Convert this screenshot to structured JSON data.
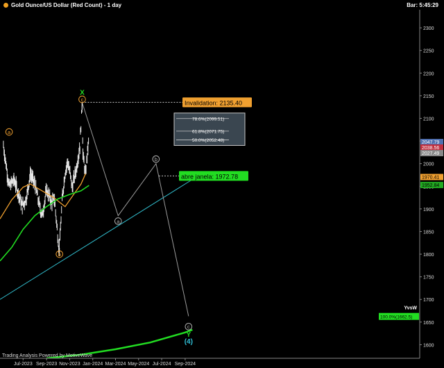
{
  "header": {
    "title": "Gold Ounce/US Dollar (Red Count) - 1 day",
    "clock": "Bar: 5:45:29"
  },
  "footer": {
    "credit": "Trading Analysis Powered by MotiveWave"
  },
  "colors": {
    "background": "#000000",
    "price": "#e8e8e8",
    "ma_orange": "#f0a030",
    "ma_green": "#22dd22",
    "channel": "#30b8c8",
    "projection": "#9a9a9a",
    "wave_orange": "#f0a030",
    "wave_green": "#22dd22",
    "wave_gray": "#b0b0b0",
    "wave_cyan": "#30c0d8"
  },
  "chart_data": {
    "type": "line",
    "title": "Gold Ounce/US Dollar (Red Count) - 1 day",
    "x_ticks": [
      "Jul-2023",
      "Sep-2023",
      "Nov-2023",
      "Jan-2024",
      "Mar-2024",
      "May-2024",
      "Jul-2024",
      "Sep-2024"
    ],
    "y_ticks": [
      1600,
      1650,
      1700,
      1750,
      1800,
      1850,
      1900,
      1950,
      2000,
      2050,
      2100,
      2150,
      2200,
      2250,
      2300
    ],
    "ylim": [
      1570,
      2340
    ],
    "price_keypoints": [
      {
        "date": "2023-05-10",
        "price": 2040
      },
      {
        "date": "2023-05-25",
        "price": 1950
      },
      {
        "date": "2023-06-07",
        "price": 1965
      },
      {
        "date": "2023-06-20",
        "price": 1930
      },
      {
        "date": "2023-06-29",
        "price": 1905
      },
      {
        "date": "2023-07-10",
        "price": 1925
      },
      {
        "date": "2023-07-20",
        "price": 1978
      },
      {
        "date": "2023-08-01",
        "price": 1955
      },
      {
        "date": "2023-08-15",
        "price": 1900
      },
      {
        "date": "2023-08-21",
        "price": 1887
      },
      {
        "date": "2023-09-01",
        "price": 1942
      },
      {
        "date": "2023-09-14",
        "price": 1915
      },
      {
        "date": "2023-09-22",
        "price": 1920
      },
      {
        "date": "2023-10-03",
        "price": 1818
      },
      {
        "date": "2023-10-05",
        "price": 1815
      },
      {
        "date": "2023-10-13",
        "price": 1930
      },
      {
        "date": "2023-10-20",
        "price": 1980
      },
      {
        "date": "2023-10-27",
        "price": 2005
      },
      {
        "date": "2023-11-08",
        "price": 1948
      },
      {
        "date": "2023-11-20",
        "price": 1995
      },
      {
        "date": "2023-11-28",
        "price": 2040
      },
      {
        "date": "2023-12-04",
        "price": 2135
      },
      {
        "date": "2023-12-06",
        "price": 2020
      },
      {
        "date": "2023-12-13",
        "price": 1975
      },
      {
        "date": "2023-12-18",
        "price": 2028
      },
      {
        "date": "2023-12-22",
        "price": 2055
      }
    ],
    "series": [
      {
        "name": "orange_ma",
        "points": [
          {
            "date": "2023-05-01",
            "price": 1878
          },
          {
            "date": "2023-06-01",
            "price": 1920
          },
          {
            "date": "2023-07-01",
            "price": 1948
          },
          {
            "date": "2023-07-20",
            "price": 1955
          },
          {
            "date": "2023-08-20",
            "price": 1940
          },
          {
            "date": "2023-09-20",
            "price": 1925
          },
          {
            "date": "2023-10-20",
            "price": 1905
          },
          {
            "date": "2023-11-10",
            "price": 1930
          },
          {
            "date": "2023-12-01",
            "price": 1955
          },
          {
            "date": "2023-12-13",
            "price": 1978
          }
        ]
      },
      {
        "name": "green_ma",
        "points": [
          {
            "date": "2023-05-01",
            "price": 1785
          },
          {
            "date": "2023-06-01",
            "price": 1815
          },
          {
            "date": "2023-07-01",
            "price": 1855
          },
          {
            "date": "2023-08-01",
            "price": 1885
          },
          {
            "date": "2023-09-01",
            "price": 1905
          },
          {
            "date": "2023-10-01",
            "price": 1922
          },
          {
            "date": "2023-11-01",
            "price": 1932
          },
          {
            "date": "2023-12-01",
            "price": 1940
          },
          {
            "date": "2023-12-22",
            "price": 1952
          }
        ]
      },
      {
        "name": "cyan_channel",
        "points": [
          {
            "date": "2023-05-01",
            "price": 1700
          },
          {
            "date": "2024-09-20",
            "price": 1965
          }
        ]
      },
      {
        "name": "long_green",
        "points": [
          {
            "date": "2023-09-01",
            "price": 1570
          },
          {
            "date": "2023-12-01",
            "price": 1578
          },
          {
            "date": "2024-03-01",
            "price": 1590
          },
          {
            "date": "2024-06-01",
            "price": 1605
          },
          {
            "date": "2024-09-01",
            "price": 1627
          },
          {
            "date": "2024-09-20",
            "price": 1633
          }
        ]
      },
      {
        "name": "projection",
        "points": [
          {
            "date": "2023-12-04",
            "price": 2135
          },
          {
            "date": "2024-03-08",
            "price": 1885
          },
          {
            "date": "2024-06-16",
            "price": 2000
          },
          {
            "date": "2024-09-10",
            "price": 1663
          }
        ]
      }
    ],
    "wave_labels": [
      {
        "text": "a",
        "date": "2023-05-25",
        "price": 2070,
        "color": "orange",
        "circle": true
      },
      {
        "text": "b",
        "date": "2023-10-05",
        "price": 1800,
        "color": "orange",
        "circle": true
      },
      {
        "text": "c",
        "date": "2023-12-04",
        "price": 2142,
        "color": "orange",
        "circle": true
      },
      {
        "text": "X",
        "date": "2023-12-04",
        "price": 2158,
        "color": "green",
        "circle": false
      },
      {
        "text": "a",
        "date": "2024-03-08",
        "price": 1873,
        "color": "gray",
        "circle": true
      },
      {
        "text": "b",
        "date": "2024-06-16",
        "price": 2010,
        "color": "gray",
        "circle": true
      },
      {
        "text": "c",
        "date": "2024-09-10",
        "price": 1640,
        "color": "gray",
        "circle": true
      },
      {
        "text": "Y",
        "date": "2024-09-10",
        "price": 1624,
        "color": "green",
        "circle": false
      },
      {
        "text": "(4)",
        "date": "2024-09-10",
        "price": 1608,
        "color": "cyan",
        "circle": false
      }
    ],
    "annotations": [
      {
        "text": "Invalidation: 2135.40",
        "price": 2135.4,
        "color": "#f0a030"
      },
      {
        "text": "abre janela: 1972.78",
        "price": 1972.78,
        "color": "#22dd22"
      }
    ],
    "fib_levels": [
      {
        "text": "78.6%(2099.51)",
        "price": 2099.51
      },
      {
        "text": "61.8%(2071.75)",
        "price": 2071.75
      },
      {
        "text": "50.0%(2052.48)",
        "price": 2052.48
      }
    ],
    "price_tags": [
      {
        "text": "2047.79",
        "price": 2047.79,
        "bg": "#5070b0",
        "fg": "#ffffff"
      },
      {
        "text": "2038.56",
        "price": 2038.56,
        "bg": "#c03040",
        "fg": "#ffffff"
      },
      {
        "text": "2027.49",
        "price": 2027.49,
        "bg": "#888888",
        "fg": "#ffffff"
      },
      {
        "text": "1970.41",
        "price": 1970.41,
        "bg": "#f0a030",
        "fg": "#000000"
      },
      {
        "text": "1952.84",
        "price": 1952.84,
        "bg": "#22aa22",
        "fg": "#000000"
      }
    ],
    "target": {
      "text": "100.0%(1662.5)",
      "price": 1662.5
    },
    "target_caption": "YvsW"
  }
}
